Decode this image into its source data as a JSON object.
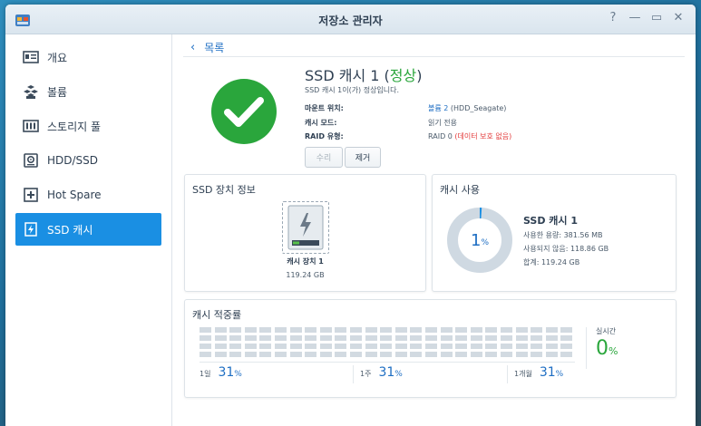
{
  "window": {
    "title": "저장소 관리자"
  },
  "sidebar": {
    "items": [
      {
        "label": "개요",
        "icon": "overview-icon",
        "active": false
      },
      {
        "label": "볼륨",
        "icon": "volume-icon",
        "active": false
      },
      {
        "label": "스토리지 풀",
        "icon": "storage-pool-icon",
        "active": false
      },
      {
        "label": "HDD/SSD",
        "icon": "disk-icon",
        "active": false
      },
      {
        "label": "Hot Spare",
        "icon": "hot-spare-icon",
        "active": false
      },
      {
        "label": "SSD 캐시",
        "icon": "ssd-cache-icon",
        "active": true
      }
    ]
  },
  "header": {
    "back_label": "목록",
    "title_prefix": "SSD 캐시 1 (",
    "title_status": "정상",
    "title_suffix": ")",
    "subtitle": "SSD 캐시 1이(가) 정상입니다.",
    "props": [
      {
        "label": "마운트 위치:",
        "value_link": "볼륨 2",
        "value_rest": " (HDD_Seagate)",
        "value_warn": ""
      },
      {
        "label": "캐시 모드:",
        "value_link": "",
        "value_rest": "읽기 전용",
        "value_warn": ""
      },
      {
        "label": "RAID 유형:",
        "value_link": "",
        "value_rest": "RAID 0 ",
        "value_warn": "(데이터 보호 없음)"
      }
    ],
    "repair_label": "수리",
    "remove_label": "제거"
  },
  "device_info": {
    "title": "SSD 장치 정보",
    "device_name": "캐시 장치 1",
    "device_size": "119.24 GB"
  },
  "cache_usage": {
    "title": "캐시 사용",
    "percent": "1",
    "percent_unit": "%",
    "used_fraction": 0.01,
    "name": "SSD 캐시 1",
    "used": "사용한 용량: 381.56 MB",
    "unused": "사용되지 않음: 118.86 GB",
    "total": "합계: 119.24 GB"
  },
  "hit_rate": {
    "title": "캐시 적중률",
    "realtime_label": "실시간",
    "realtime_value": "0",
    "realtime_unit": "%",
    "stats": [
      {
        "label": "1일",
        "value": "31",
        "unit": "%"
      },
      {
        "label": "1주",
        "value": "31",
        "unit": "%"
      },
      {
        "label": "1개월",
        "value": "31",
        "unit": "%"
      }
    ]
  },
  "colors": {
    "accent": "#1a8fe3",
    "ok_green": "#2aa63c",
    "warn_red": "#e33b3b",
    "link_blue": "#1e6ec3"
  }
}
